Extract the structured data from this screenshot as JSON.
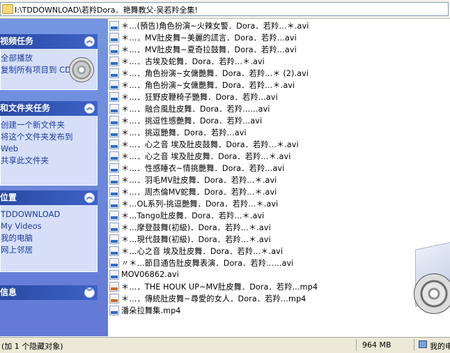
{
  "address": {
    "path": "I:\\TDDOWNLOAD\\若羚Dora．艳舞教父-吴若羚全集!"
  },
  "task_pane": {
    "groups": [
      {
        "title": "视频任务",
        "tasks": [
          "全部播放",
          "复制所有项目到 CD"
        ]
      },
      {
        "title": "和文件夹任务",
        "tasks": [
          "创建一个新文件夹",
          "将这个文件夹发布到",
          "Web",
          "共享此文件夹"
        ]
      },
      {
        "title": "位置",
        "tasks": [
          "TDDOWNLOAD",
          "My Videos",
          "我的电脑",
          "网上邻居"
        ]
      },
      {
        "title": "信息",
        "tasks": []
      }
    ]
  },
  "files": [
    {
      "name": "＊…(預告)角色扮演~火辣女警．Dora．若羚…＊.avi",
      "type": "avi"
    },
    {
      "name": "＊…．MV肚皮舞~美麗的謊言．Dora．若羚…avi",
      "type": "avi"
    },
    {
      "name": "＊…．MV肚皮舞~夏奇拉鼓舞．Dora．若羚…avi",
      "type": "avi"
    },
    {
      "name": "＊…．古埃及蛇舞．Dora．若羚…＊.avi",
      "type": "avi"
    },
    {
      "name": "＊…．角色扮演~女傭艷舞．Dora．若羚…＊ (2).avi",
      "type": "avi"
    },
    {
      "name": "＊…．角色扮演~女傭艷舞．Dora．若羚…＊.avi",
      "type": "avi"
    },
    {
      "name": "＊…．狂野皮鞭椅子艷舞．Dora．若羚…avi",
      "type": "avi"
    },
    {
      "name": "＊…．融合風肚皮舞．Dora．若羚……avi",
      "type": "avi"
    },
    {
      "name": "＊…．挑逗性感艷舞．Dora．若羚…avi",
      "type": "avi"
    },
    {
      "name": "＊…．挑逗艷舞．Dora．若羚…avi",
      "type": "avi"
    },
    {
      "name": "＊…．心之音 埃及肚皮鼓舞．Dora．若羚…＊.avi",
      "type": "avi"
    },
    {
      "name": "＊…．心之音 埃及肚皮舞．Dora．若羚…＊.avi",
      "type": "avi"
    },
    {
      "name": "＊…．性感睡衣~情挑艷舞．Dora．若羚…avi",
      "type": "avi"
    },
    {
      "name": "＊…．羽毛MV肚皮舞．Dora．若羚…＊.avi",
      "type": "avi"
    },
    {
      "name": "＊…．周杰倫MV蛇舞．Dora．若羚…＊.avi",
      "type": "avi"
    },
    {
      "name": "＊…OL系列-挑逗艷舞．Dora．若羚…＊.avi",
      "type": "avi"
    },
    {
      "name": "＊…Tango肚皮舞．Dora．若羚…＊.avi",
      "type": "avi"
    },
    {
      "name": "＊…摩登鼓舞(初級)．Dora．若羚…＊.avi",
      "type": "avi"
    },
    {
      "name": "＊…現代鼓舞(初級)．Dora．若羚…＊.avi",
      "type": "avi"
    },
    {
      "name": "＊…心之音 埃及肚皮舞．Dora．若羚…＊.avi",
      "type": "avi"
    },
    {
      "name": "〃＊…節目通告肚皮舞表演．Dora．若羚……avi",
      "type": "avi"
    },
    {
      "name": "MOV06862.avi",
      "type": "avi"
    },
    {
      "name": "＊…．THE HOUK UP~MV肚皮舞．Dora．若羚…mp4",
      "type": "mpg"
    },
    {
      "name": "＊…．傳統肚皮舞~尋愛的女人．Dora．若羚…mp4",
      "type": "mpg"
    },
    {
      "name": "潘朵拉舞集.mp4",
      "type": "avi"
    }
  ],
  "status": {
    "left": "(加 1 个隐藏对象)",
    "size": "964 MB",
    "zone": "我的电"
  }
}
